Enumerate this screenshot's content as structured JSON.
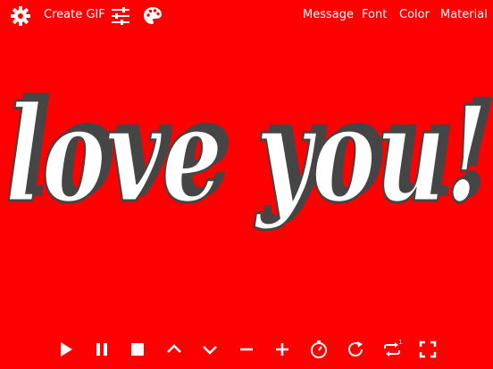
{
  "colors": {
    "background": "#ff0000",
    "text_fill": "#ffffff",
    "text_shadow": "#444444",
    "foreground": "#ffffff"
  },
  "toolbar": {
    "create_gif_label": "Create GIF",
    "icons": [
      "gear-icon",
      "sliders-icon",
      "palette-icon"
    ],
    "menu": {
      "message": "Message",
      "font": "Font",
      "color": "Color",
      "material": "Material"
    }
  },
  "canvas": {
    "message": "love you!"
  },
  "playback": {
    "icons": [
      "play-icon",
      "pause-icon",
      "stop-icon",
      "chevron-up-icon",
      "chevron-down-icon",
      "minus-icon",
      "plus-icon",
      "timer-icon",
      "rotate-icon",
      "repeat-icon",
      "fullscreen-icon"
    ],
    "repeat_badge": "1"
  }
}
